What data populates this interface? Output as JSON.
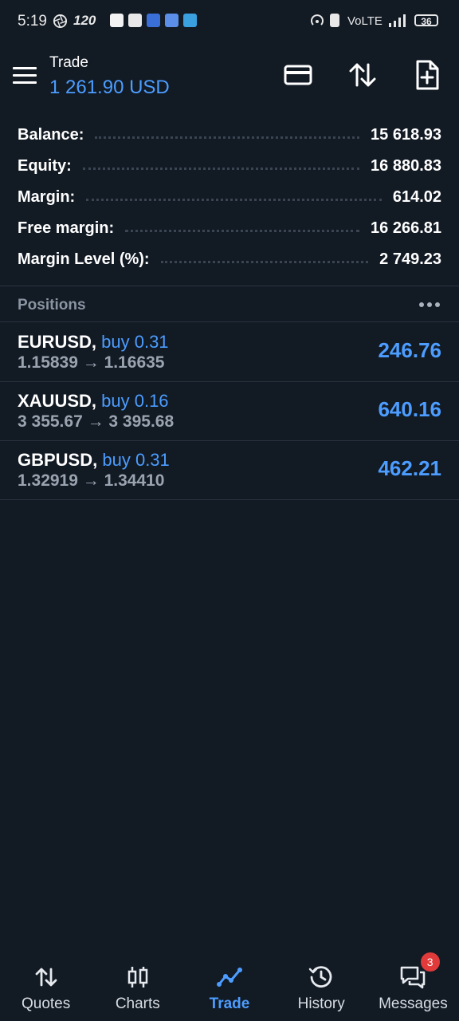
{
  "status_bar": {
    "time": "5:19",
    "refresh_rate": "120",
    "network": "VoLTE",
    "battery": "36"
  },
  "header": {
    "title": "Trade",
    "amount": "1 261.90 USD",
    "icons": [
      "card-icon",
      "sort-icon",
      "new-order-icon"
    ]
  },
  "account": [
    {
      "label": "Balance:",
      "value": "15 618.93"
    },
    {
      "label": "Equity:",
      "value": "16 880.83"
    },
    {
      "label": "Margin:",
      "value": "614.02"
    },
    {
      "label": "Free margin:",
      "value": "16 266.81"
    },
    {
      "label": "Margin Level (%):",
      "value": "2 749.23"
    }
  ],
  "positions_title": "Positions",
  "positions": [
    {
      "symbol": "EURUSD,",
      "side": "buy 0.31",
      "prices": "1.15839 → 1.16635",
      "profit": "246.76"
    },
    {
      "symbol": "XAUUSD,",
      "side": "buy 0.16",
      "prices": "3 355.67 → 3 395.68",
      "profit": "640.16"
    },
    {
      "symbol": "GBPUSD,",
      "side": "buy 0.31",
      "prices": "1.32919 → 1.34410",
      "profit": "462.21"
    }
  ],
  "nav": {
    "quotes": "Quotes",
    "charts": "Charts",
    "trade": "Trade",
    "history": "History",
    "messages": "Messages",
    "messages_badge": "3"
  },
  "colors": {
    "background": "#121a24",
    "accent": "#4c9dff",
    "badge": "#e03a3a"
  }
}
